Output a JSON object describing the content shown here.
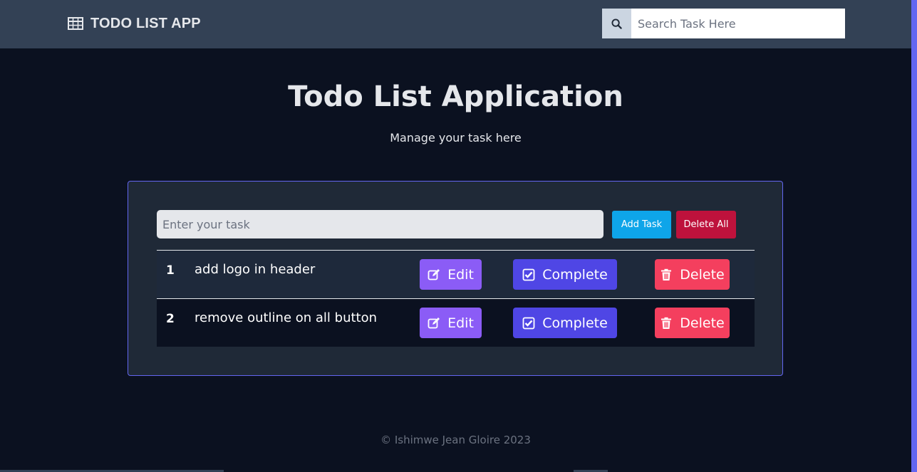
{
  "navbar": {
    "brand_icon": "table-icon",
    "brand_title": "TODO LIST APP",
    "search": {
      "icon": "search-icon",
      "placeholder": "Search Task Here",
      "value": ""
    }
  },
  "hero": {
    "title": "Todo List Application",
    "subtitle": "Manage your task here"
  },
  "form": {
    "input_placeholder": "Enter your task",
    "input_value": "",
    "add_label": "Add Task",
    "delete_all_label": "Delete All"
  },
  "tasks": [
    {
      "num": "1",
      "text": "add logo in header",
      "edit_label": "Edit",
      "complete_label": "Complete",
      "delete_label": "Delete"
    },
    {
      "num": "2",
      "text": "remove outline on all button",
      "edit_label": "Edit",
      "complete_label": "Complete",
      "delete_label": "Delete"
    }
  ],
  "footer": {
    "text": "© Ishimwe Jean Gloire 2023"
  },
  "colors": {
    "background": "#0b1120",
    "navbar": "#334155",
    "card": "#1f2937",
    "accent_border": "#6366f1",
    "add": "#0ea5e9",
    "delete_all": "#be123c",
    "edit": "#8b5cf6",
    "complete": "#4f46e5",
    "delete": "#f43f5e"
  }
}
